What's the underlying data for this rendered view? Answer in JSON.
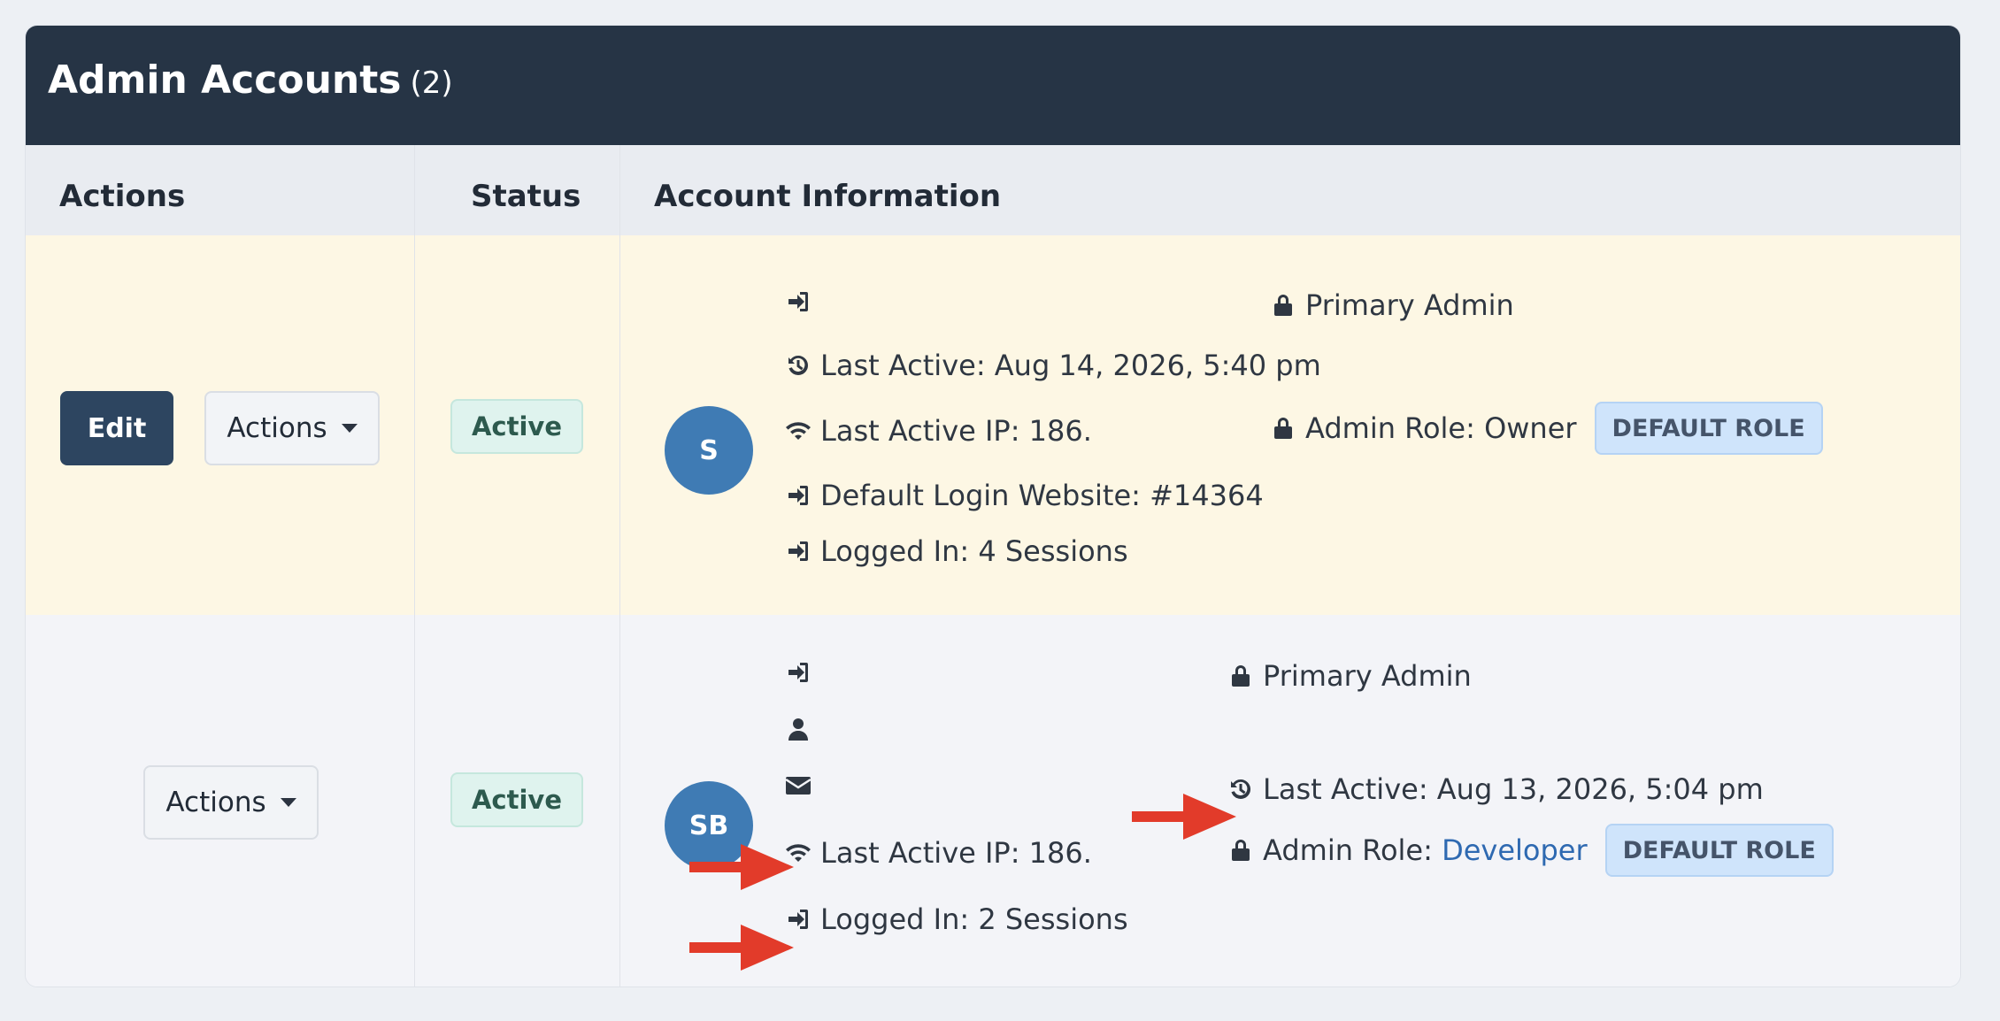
{
  "header": {
    "title": "Admin Accounts",
    "count": "(2)"
  },
  "columns": {
    "actions": "Actions",
    "status": "Status",
    "account_info": "Account Information"
  },
  "rows": [
    {
      "edit_label": "Edit",
      "actions_label": "Actions",
      "status": "Active",
      "avatar": "S",
      "left_items": [
        {
          "icon": "sign-in-icon",
          "text": ""
        },
        {
          "icon": "history-icon",
          "text": "Last Active: Aug 14, 2026, 5:40 pm"
        },
        {
          "icon": "wifi-icon",
          "text": "Last Active IP: 186."
        },
        {
          "icon": "sign-in-icon",
          "text": "Default Login Website: #14364"
        },
        {
          "icon": "sign-in-icon",
          "text": "Logged In: 4 Sessions"
        }
      ],
      "right_items": [
        {
          "icon": "lock-icon",
          "text": "Primary Admin"
        },
        {
          "icon": "lock-icon",
          "text": "Admin Role: Owner",
          "badge": "DEFAULT ROLE"
        }
      ]
    },
    {
      "actions_label": "Actions",
      "status": "Active",
      "avatar": "SB",
      "left_items": [
        {
          "icon": "sign-in-icon",
          "text": ""
        },
        {
          "icon": "user-icon",
          "text": ""
        },
        {
          "icon": "envelope-icon",
          "text": ""
        },
        {
          "icon": "wifi-icon",
          "text": "Last Active IP: 186."
        },
        {
          "icon": "sign-in-icon",
          "text": "Logged In: 2 Sessions"
        }
      ],
      "right_items": [
        {
          "icon": "lock-icon",
          "text": "Primary Admin"
        },
        {
          "icon": "history-icon",
          "text": "Last Active: Aug 13, 2026, 5:04 pm"
        },
        {
          "icon": "lock-icon",
          "text": "Admin Role: ",
          "link": "Developer",
          "badge": "DEFAULT ROLE"
        }
      ]
    }
  ],
  "colors": {
    "header_bg": "#263445",
    "edit_button": "#2d4560",
    "avatar": "#3f7bb4",
    "highlight_row": "#fdf7e4",
    "annotation_arrow": "#e23b2a"
  }
}
